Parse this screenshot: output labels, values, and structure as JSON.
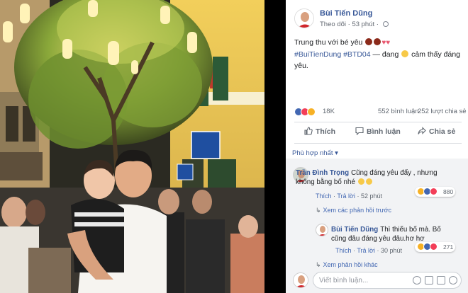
{
  "post": {
    "author": "Bùi Tiến Dũng",
    "follow": "Theo dõi",
    "time": "53 phút",
    "text_line1": "Trung thu với bé yêu",
    "hashtags": "#BuiTienDung #BTD04",
    "feeling_prefix": "— đang",
    "feeling": "cảm thấy đáng",
    "feeling_line2": "yêu."
  },
  "stats": {
    "reactions_count": "18K",
    "comments_count": "552 bình luận",
    "shares_count": "252 lượt chia sẻ"
  },
  "actions": {
    "like": "Thích",
    "comment": "Bình luận",
    "share": "Chia sẻ"
  },
  "sort_label": "Phù hợp nhất ▾",
  "comments": [
    {
      "author": "Trần Đình Trọng",
      "text": "Cũng đáng yêu đấy , nhưng không bằng bố nhé",
      "like": "Thích",
      "reply": "Trả lời",
      "time": "52 phút",
      "reactions": "880",
      "view_replies": "Xem các phản hồi trước"
    },
    {
      "author": "Bùi Tiến Dũng",
      "text": "Thì thiếu bố mà. Bố cũng đâu đáng yêu đâu.hơ hơ",
      "like": "Thích",
      "reply": "Trả lời",
      "time": "30 phút",
      "reactions": "271",
      "view_replies": "Xem phản hồi khác"
    }
  ],
  "composer": {
    "placeholder": "Viết bình luận..."
  },
  "colors": {
    "link": "#385898",
    "like_blue": "#4267b2",
    "love_red": "#f33e58",
    "haha_yellow": "#f7b125",
    "panel_bg": "#ffffff",
    "comment_bg": "#f2f3f5"
  },
  "icons": [
    "globe-icon",
    "like-icon",
    "comment-icon",
    "share-icon",
    "emoji-icon",
    "camera-icon",
    "gif-icon",
    "sticker-icon"
  ]
}
